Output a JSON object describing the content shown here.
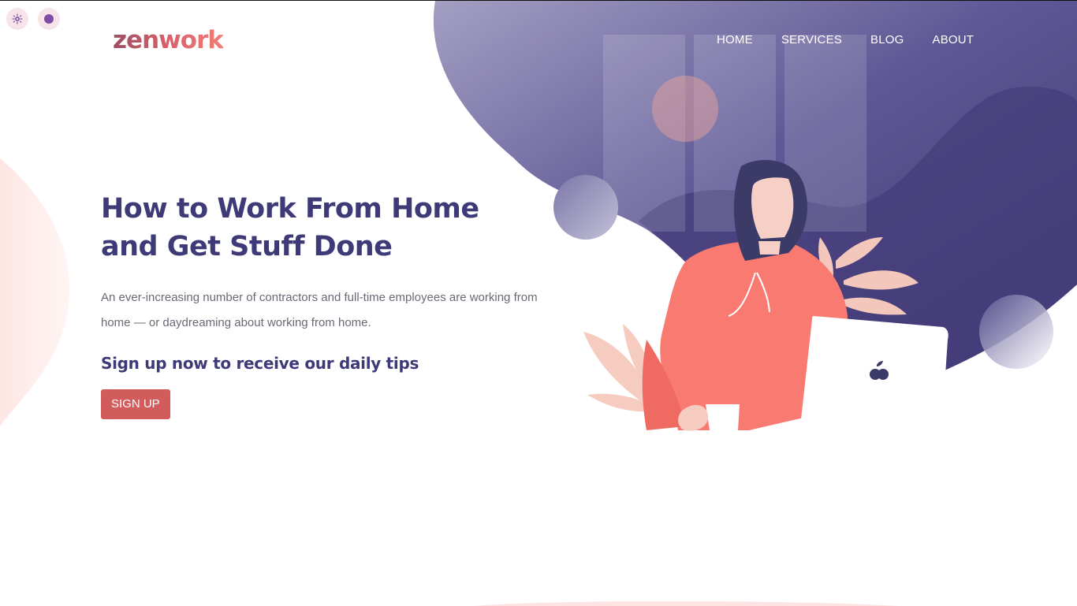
{
  "header": {
    "logo_text": "zenwork",
    "nav": [
      {
        "label": "HOME"
      },
      {
        "label": "SERVICES"
      },
      {
        "label": "BLOG"
      },
      {
        "label": "ABOUT"
      }
    ]
  },
  "toolbar": {
    "theme_toggle_icon": "gear-icon",
    "accent_dot_icon": "circle-dot-icon"
  },
  "hero": {
    "title_line_1": "How to Work From Home",
    "title_line_2": "and Get Stuff Done",
    "description": "An ever-increasing number of contractors and full-time employees are working from home — or daydreaming about working from home.",
    "cta_heading": "Sign up now to receive our daily tips",
    "cta_button": "SIGN UP"
  },
  "colors": {
    "brand_purple": "#3e3a78",
    "accent_coral": "#d25b5c",
    "blob_purple": "#4c4382"
  }
}
